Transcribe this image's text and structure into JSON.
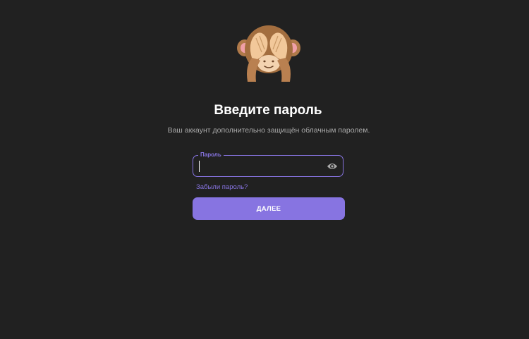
{
  "header": {
    "title": "Введите пароль",
    "subtitle": "Ваш аккаунт дополнительно защищён облачным паролем."
  },
  "password_field": {
    "label": "Пароль",
    "value": "",
    "toggle_icon": "eye-icon"
  },
  "links": {
    "forgot_password": "Забыли пароль?"
  },
  "actions": {
    "next_label": "ДАЛЕЕ"
  },
  "colors": {
    "background": "#212121",
    "accent": "#8774e1",
    "text_primary": "#ffffff",
    "text_secondary": "#aaaaaa"
  },
  "illustration": {
    "icon": "see-no-evil-monkey-icon"
  }
}
